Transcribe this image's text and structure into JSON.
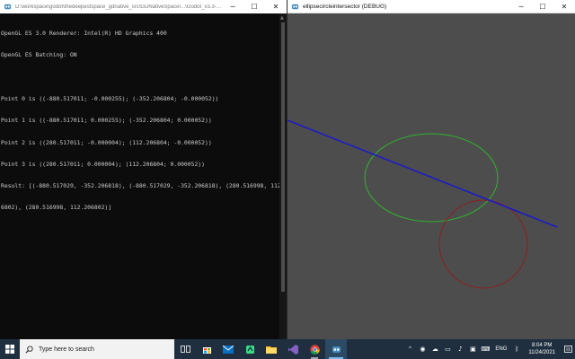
{
  "console_window": {
    "title": "D:\\workspace\\godot\\thedeepestspace_gdnative_src\\GDNativeSpace\\...\\Godot_v3.3-st...",
    "icon": "godot-console-icon",
    "lines": [
      "OpenGL ES 3.0 Renderer: Intel(R) HD Graphics 400",
      "OpenGL ES Batching: ON",
      "",
      "Point 0 is ((-880.517011; -0.000255); (-352.206804; -0.000052))",
      "Point 1 is ((-880.517011; 0.000255); (-352.206804; 0.000052))",
      "Point 2 is ((280.517011; -0.000004); (112.206804; -0.000052))",
      "Point 3 is ((280.517011; 0.000004); (112.206804; 0.000052))",
      "Result: [(-880.517029, -352.206818), (-880.517029, -352.206818), (280.516998, 112.20",
      "6802), (280.516998, 112.206802)]"
    ]
  },
  "game_window": {
    "title": "ellipsecircleintersector (DEBUG)",
    "icon": "godot-icon",
    "controls": {
      "minimize": "─",
      "maximize": "☐",
      "close": "✕"
    },
    "background_color": "#4d4d4d",
    "ellipse_color": "#2fb52f",
    "circle_color": "#8b1f1f",
    "line_color": "#1a1acc"
  },
  "taskbar": {
    "search_placeholder": "Type here to search",
    "pinned": [
      "task-view-icon",
      "store-icon",
      "mail-icon",
      "android-studio-icon",
      "file-explorer-icon",
      "visual-studio-icon",
      "chrome-icon",
      "godot-icon"
    ],
    "tray": {
      "language": "ENG",
      "time": "8:04 PM",
      "date": "11/24/2021"
    }
  }
}
